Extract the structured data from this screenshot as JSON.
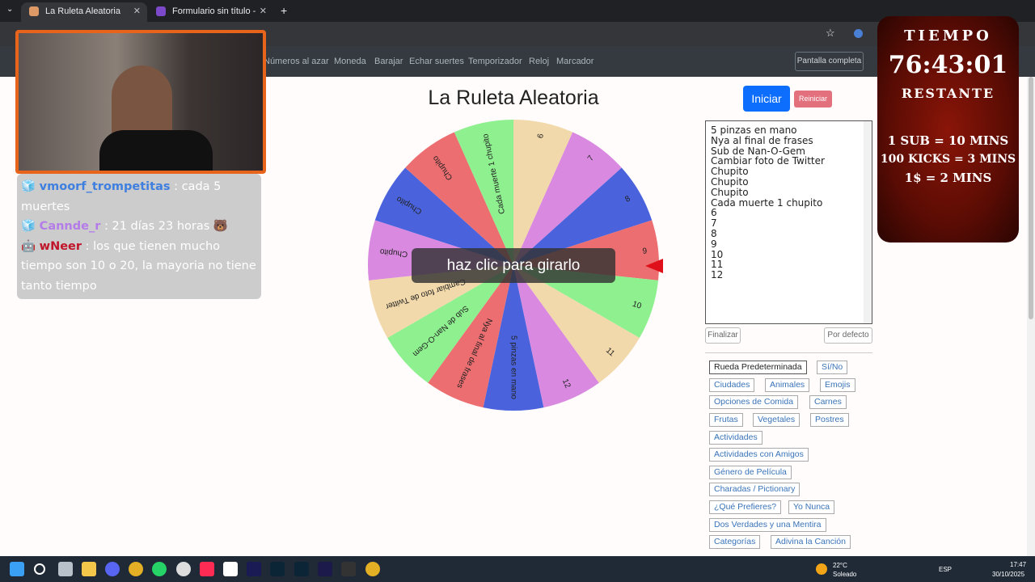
{
  "browser": {
    "tabs": [
      {
        "title": "La Ruleta Aleatoria",
        "active": true
      },
      {
        "title": "Formulario sin título - Formular",
        "active": false
      }
    ],
    "new_tab": "+"
  },
  "nav": {
    "items": [
      "Números al azar",
      "Moneda",
      "Barajar",
      "Echar suertes",
      "Temporizador",
      "Reloj",
      "Marcador"
    ],
    "fullscreen": "Pantalla completa"
  },
  "page": {
    "title": "La Ruleta Aleatoria",
    "spin_prompt": "haz clic para girarlo",
    "start": "Iniciar",
    "reset": "Reiniciar",
    "entries": [
      "5 pinzas en mano",
      "Nya al final de frases",
      "Sub de Nan-O-Gem",
      "Cambiar foto de Twitter",
      "Chupito",
      "Chupito",
      "Chupito",
      "Cada muerte 1 chupito",
      "6",
      "7",
      "8",
      "9",
      "10",
      "11",
      "12"
    ],
    "finish": "Finalizar",
    "default": "Por defecto",
    "presets": [
      "Rueda Predeterminada",
      "Sí/No",
      "Ciudades",
      "Animales",
      "Emojis",
      "Opciones de Comida",
      "Carnes",
      "Frutas",
      "Vegetales",
      "Postres",
      "Actividades",
      "Actividades con Amigos",
      "Género de Película",
      "Charadas / Pictionary",
      "¿Qué Prefieres?",
      "Yo Nunca",
      "Dos Verdades y una Mentira",
      "Categorías",
      "Adivina la Canción"
    ],
    "wheel_segments": [
      {
        "label": "5 pinzas en mano",
        "color": "#4a63dc"
      },
      {
        "label": "Nya al final de frases",
        "color": "#ec6e71"
      },
      {
        "label": "Sub de Nan-O-Gem",
        "color": "#8ef08f"
      },
      {
        "label": "Cambiar foto de Twitter",
        "color": "#f2d9ab"
      },
      {
        "label": "Chupito",
        "color": "#d98ae0"
      },
      {
        "label": "Chupito",
        "color": "#4a63dc"
      },
      {
        "label": "Chupito",
        "color": "#ec6e71"
      },
      {
        "label": "Cada muerte 1 chupito",
        "color": "#8ef08f"
      },
      {
        "label": "6",
        "color": "#f2d9ab"
      },
      {
        "label": "7",
        "color": "#d98ae0"
      },
      {
        "label": "8",
        "color": "#4a63dc"
      },
      {
        "label": "9",
        "color": "#ec6e71"
      },
      {
        "label": "10",
        "color": "#8ef08f"
      },
      {
        "label": "11",
        "color": "#f2d9ab"
      },
      {
        "label": "12",
        "color": "#d98ae0"
      }
    ]
  },
  "chat": [
    {
      "user": "vmoorf_trompetitas",
      "message": " : cada 5 muertes",
      "color": "#3f7fe0"
    },
    {
      "user": "Canndе_r",
      "message": " : 21 días 23 horas 🐻",
      "color": "#b47ce8"
    },
    {
      "user": "wNeer",
      "message": " : los que tienen mucho tiempo son 10 o 20, la mayoria no tiene tanto tiempo",
      "color": "#c0152a"
    }
  ],
  "timer": {
    "label": "TIEMPO",
    "value": "76:43:01",
    "sublabel": "RESTANTE",
    "rule1": "1 SUB = 10 MINS",
    "rule2": "100 KICKS = 3 MINS",
    "rule3": "1$ = 2 MINS"
  },
  "taskbar": {
    "weather_temp": "22°C",
    "weather_desc": "Soleado",
    "lang": "ESP",
    "time": "17:47",
    "date": "30/10/2025"
  }
}
